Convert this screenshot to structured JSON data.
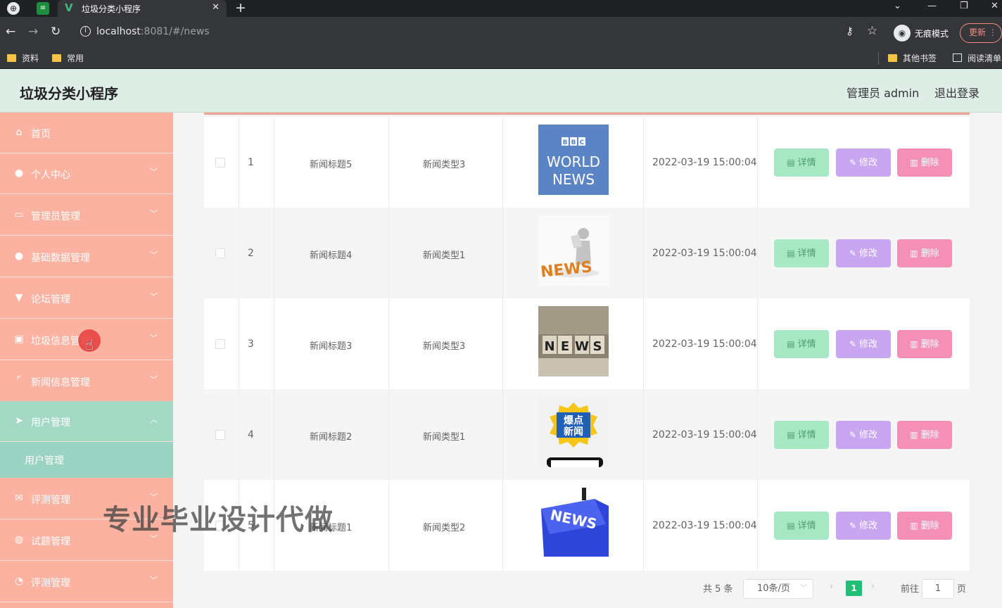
{
  "browser": {
    "tab_title": "垃圾分类小程序",
    "url_host": "localhost",
    "url_rest": ":8081/#/news",
    "incognito_label": "无痕模式",
    "update_label": "更新",
    "bookmarks_left": [
      "资料",
      "常用"
    ],
    "bookmarks_right": [
      "其他书签",
      "阅读清单"
    ]
  },
  "header": {
    "title": "垃圾分类小程序",
    "admin": "管理员 admin",
    "logout": "退出登录"
  },
  "sidebar": {
    "items": [
      {
        "label": "首页",
        "icon": "home-icon",
        "has_chevron": false
      },
      {
        "label": "个人中心",
        "icon": "user-icon",
        "has_chevron": true
      },
      {
        "label": "管理员管理",
        "icon": "card-icon",
        "has_chevron": true
      },
      {
        "label": "基础数据管理",
        "icon": "user-icon",
        "has_chevron": true
      },
      {
        "label": "论坛管理",
        "icon": "pin-icon",
        "has_chevron": true
      },
      {
        "label": "垃圾信息管理",
        "icon": "trash-icon",
        "has_chevron": true
      },
      {
        "label": "新闻信息管理",
        "icon": "frame-icon",
        "has_chevron": true
      },
      {
        "label": "用户管理",
        "icon": "send-icon",
        "has_chevron": true
      },
      {
        "label": "评测管理",
        "icon": "mail-icon",
        "has_chevron": true
      },
      {
        "label": "试题管理",
        "icon": "globe-icon",
        "has_chevron": true
      },
      {
        "label": "评测管理",
        "icon": "bell-icon",
        "has_chevron": true
      }
    ],
    "open_sub": "用户管理"
  },
  "table": {
    "rows": [
      {
        "index": "1",
        "title": "新闻标题5",
        "type": "新闻类型3",
        "image": "BBC WORLD NEWS",
        "date": "2022-03-19 15:00:04"
      },
      {
        "index": "2",
        "title": "新闻标题4",
        "type": "新闻类型1",
        "image": "NEWS",
        "date": "2022-03-19 15:00:04"
      },
      {
        "index": "3",
        "title": "新闻标题3",
        "type": "新闻类型3",
        "image": "NEWS",
        "date": "2022-03-19 15:00:04"
      },
      {
        "index": "4",
        "title": "新闻标题2",
        "type": "新闻类型1",
        "image": "爆点新闻",
        "date": "2022-03-19 15:00:04"
      },
      {
        "index": "5",
        "title": "新闻标题1",
        "type": "新闻类型2",
        "image": "NEWS",
        "date": "2022-03-19 15:00:04"
      }
    ],
    "actions": {
      "detail": "详情",
      "edit": "修改",
      "delete": "删除"
    }
  },
  "pager": {
    "total": "共 5 条",
    "page_size": "10条/页",
    "current": "1",
    "goto_label": "前往",
    "goto_value": "1",
    "page_suffix": "页"
  },
  "watermark": "专业毕业设计代做"
}
